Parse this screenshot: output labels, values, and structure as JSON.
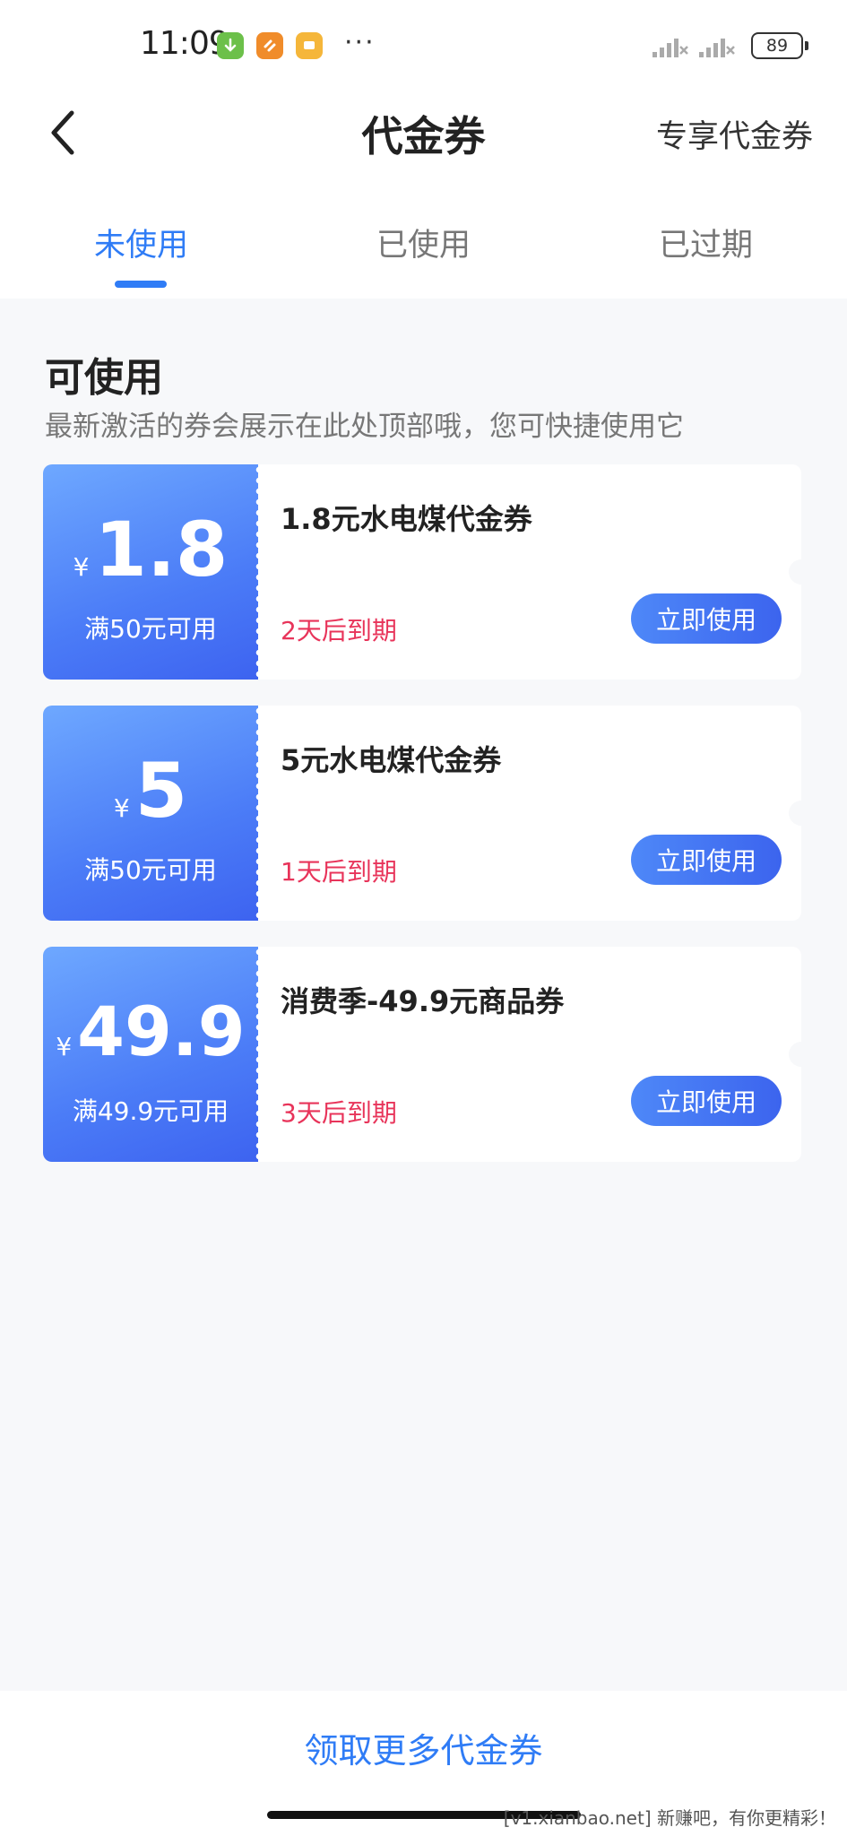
{
  "status_bar": {
    "time": "11:09",
    "battery": "89",
    "overflow": "···"
  },
  "header": {
    "title": "代金券",
    "right_action": "专享代金券"
  },
  "tabs": [
    {
      "label": "未使用",
      "active": true
    },
    {
      "label": "已使用",
      "active": false
    },
    {
      "label": "已过期",
      "active": false
    }
  ],
  "section": {
    "title": "可使用",
    "subtitle": "最新激活的券会展示在此处顶部哦，您可快捷使用它"
  },
  "coupons": [
    {
      "currency": "¥",
      "amount": "1.8",
      "condition": "满50元可用",
      "name": "1.8元水电煤代金券",
      "expiry": "2天后到期",
      "button": "立即使用"
    },
    {
      "currency": "¥",
      "amount": "5",
      "condition": "满50元可用",
      "name": "5元水电煤代金券",
      "expiry": "1天后到期",
      "button": "立即使用"
    },
    {
      "currency": "¥",
      "amount": "49.9",
      "condition": "满49.9元可用",
      "name": "消费季-49.9元商品券",
      "expiry": "3天后到期",
      "button": "立即使用"
    }
  ],
  "bottom": {
    "link": "领取更多代金券"
  },
  "watermark": "[v1.xianbao.net] 新赚吧，有你更精彩！",
  "colors": {
    "accent": "#2f7cf6",
    "coupon_gradient_start": "#6ea8ff",
    "coupon_gradient_end": "#3d63f0",
    "expiry": "#e8345a"
  },
  "icons": {
    "status_apps": [
      "download-app-icon",
      "orange-app-icon",
      "chat-app-icon"
    ],
    "back": "chevron-left-icon"
  }
}
